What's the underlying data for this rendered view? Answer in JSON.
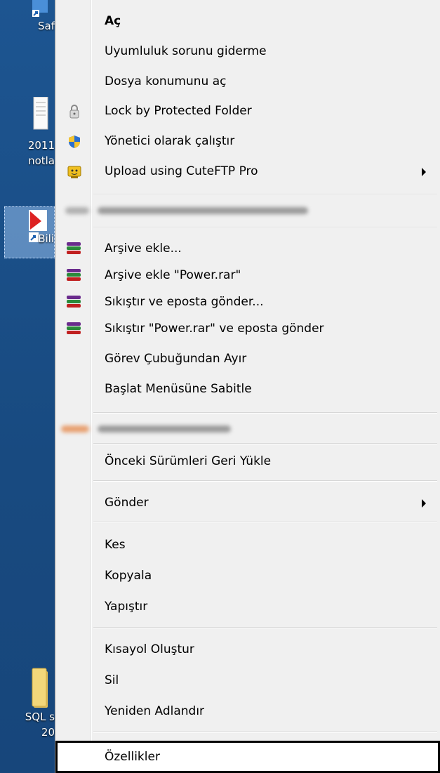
{
  "desktop": {
    "icons": [
      {
        "label_1": "Saf",
        "label_2": ""
      },
      {
        "label_1": "2011",
        "label_2": "notla"
      },
      {
        "label_1": "Bili",
        "label_2": ""
      },
      {
        "label_1": "SQL s",
        "label_2": "20"
      }
    ]
  },
  "menu": {
    "items": [
      {
        "label": "Aç"
      },
      {
        "label": "Uyumluluk sorunu giderme"
      },
      {
        "label": "Dosya konumunu aç"
      },
      {
        "label": "Lock by Protected Folder",
        "icon": "lock-icon"
      },
      {
        "label": "Yönetici olarak çalıştır",
        "icon": "uac-shield-icon"
      },
      {
        "label": "Upload using CuteFTP Pro",
        "icon": "cuteftp-icon"
      },
      {
        "label": "Arşive ekle...",
        "icon": "winrar-icon"
      },
      {
        "label": "Arşive ekle \"Power.rar\"",
        "icon": "winrar-icon"
      },
      {
        "label": "Sıkıştır ve eposta gönder...",
        "icon": "winrar-icon"
      },
      {
        "label": "Sıkıştır \"Power.rar\" ve eposta gönder",
        "icon": "winrar-icon"
      },
      {
        "label": "Görev Çubuğundan Ayır"
      },
      {
        "label": "Başlat Menüsüne Sabitle"
      },
      {
        "label": "Önceki Sürümleri Geri Yükle"
      },
      {
        "label": "Gönder"
      },
      {
        "label": "Kes"
      },
      {
        "label": "Kopyala"
      },
      {
        "label": "Yapıştır"
      },
      {
        "label": "Kısayol Oluştur"
      },
      {
        "label": "Sil"
      },
      {
        "label": "Yeniden Adlandır"
      },
      {
        "label": "Özellikler"
      }
    ]
  },
  "colors": {
    "desktop_bg": "#1b4f86",
    "menu_bg": "#f0f0f0",
    "highlight_border": "#000000"
  }
}
